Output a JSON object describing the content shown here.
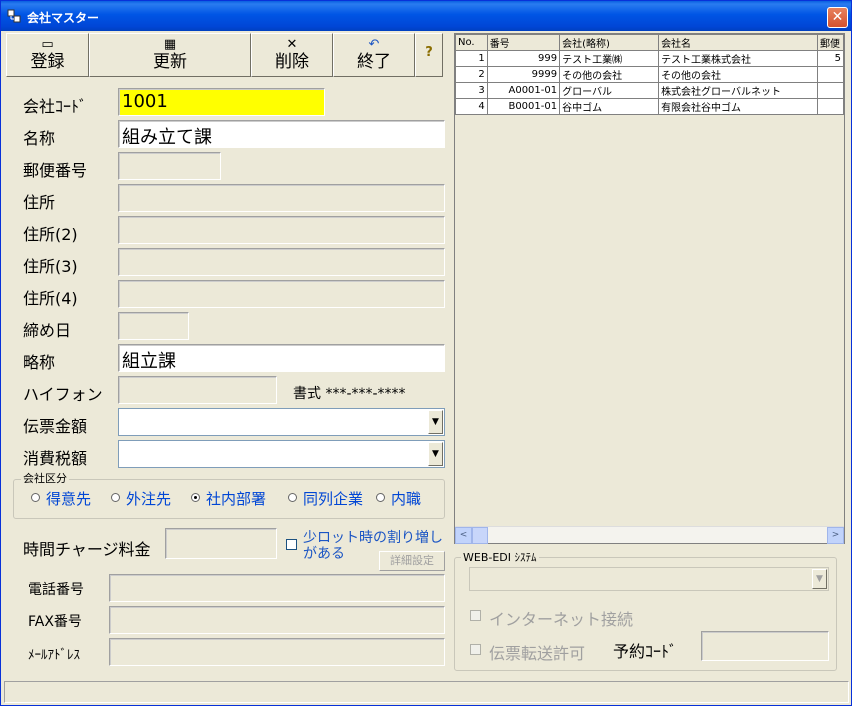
{
  "window": {
    "title": "会社マスター",
    "close_glyph": "✕"
  },
  "toolbar": {
    "register": {
      "label": "登録",
      "icon": "square-icon",
      "glyph": "▭"
    },
    "update": {
      "label": "更新",
      "icon": "grid-icon",
      "glyph": "▦"
    },
    "delete": {
      "label": "削除",
      "icon": "x-icon",
      "glyph": "✕"
    },
    "exit": {
      "label": "終了",
      "icon": "undo-icon",
      "glyph": "↶"
    },
    "help": {
      "icon": "help-icon",
      "glyph": "?"
    }
  },
  "form": {
    "company_code": {
      "label": "会社ｺｰﾄﾞ",
      "value": "1001"
    },
    "name": {
      "label": "名称",
      "value": "組み立て課"
    },
    "postal": {
      "label": "郵便番号",
      "value": ""
    },
    "address1": {
      "label": "住所",
      "value": ""
    },
    "address2": {
      "label": "住所(2)",
      "value": ""
    },
    "address3": {
      "label": "住所(3)",
      "value": ""
    },
    "address4": {
      "label": "住所(4)",
      "value": ""
    },
    "closing_day": {
      "label": "締め日",
      "value": ""
    },
    "short_name": {
      "label": "略称",
      "value": "組立課"
    },
    "hyphen": {
      "label": "ハイフォン",
      "value": "",
      "format_text": "書式 ***-***-****"
    },
    "slip_amount": {
      "label": "伝票金額",
      "value": ""
    },
    "tax_amount": {
      "label": "消費税額",
      "value": ""
    },
    "company_kubun": {
      "legend": "会社区分",
      "options": [
        "得意先",
        "外注先",
        "社内部署",
        "同列企業",
        "内職"
      ],
      "selected": "社内部署"
    },
    "hourly_charge": {
      "label": "時間チャージ料金",
      "value": ""
    },
    "small_lot": {
      "label_line1": "少ロット時の割り増し",
      "label_line2": "がある",
      "checked": false
    },
    "detail_settings_label": "詳細設定",
    "phone": {
      "label": "電話番号",
      "value": ""
    },
    "fax": {
      "label": "FAX番号",
      "value": ""
    },
    "email": {
      "label": "ﾒｰﾙｱﾄﾞﾚｽ",
      "value": ""
    }
  },
  "grid": {
    "columns": [
      "No.",
      "番号",
      "会社(略称)",
      "会社名",
      "郵便"
    ],
    "rows": [
      [
        "1",
        "999",
        "テスト工業㈱",
        "テスト工業株式会社",
        "5"
      ],
      [
        "2",
        "9999",
        "その他の会社",
        "その他の会社",
        ""
      ],
      [
        "3",
        "A0001-01",
        "グローバル",
        "株式会社グローバルネット",
        ""
      ],
      [
        "4",
        "B0001-01",
        "谷中ゴム",
        "有限会社谷中ゴム",
        ""
      ]
    ]
  },
  "scrollbar": {
    "left_glyph": "<",
    "right_glyph": ">"
  },
  "webedi": {
    "legend": "WEB-EDI ｼｽﾃﾑ",
    "internet": {
      "label": "インターネット接続",
      "checked": false
    },
    "slip_transfer": {
      "label": "伝票転送許可",
      "checked": false
    },
    "reserve_code": {
      "label": "予約ｺｰﾄﾞ",
      "value": ""
    }
  }
}
